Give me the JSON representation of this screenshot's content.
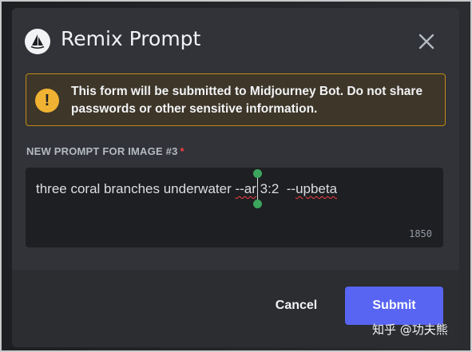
{
  "modal": {
    "title": "Remix Prompt",
    "warning": {
      "prefix": "This form will be submitted to ",
      "bold_name": "Midjourney Bot",
      "suffix": ". Do not share passwords or other sensitive information."
    },
    "field": {
      "label": "NEW PROMPT FOR IMAGE #3",
      "required_mark": "*",
      "value_part1": "three coral branches underwater ",
      "value_flag1": "--ar",
      "value_part2": " 3:2  --",
      "value_flag2": "upbeta",
      "char_count": "1850"
    },
    "footer": {
      "cancel_label": "Cancel",
      "submit_label": "Submit"
    }
  },
  "watermark": "知乎 @功夫熊",
  "colors": {
    "modal_bg": "#313338",
    "footer_bg": "#2b2d31",
    "input_bg": "#1e1f22",
    "accent": "#5865f2",
    "warning_border": "#c08b17",
    "warning_icon": "#f0b232",
    "required": "#f23f43"
  }
}
